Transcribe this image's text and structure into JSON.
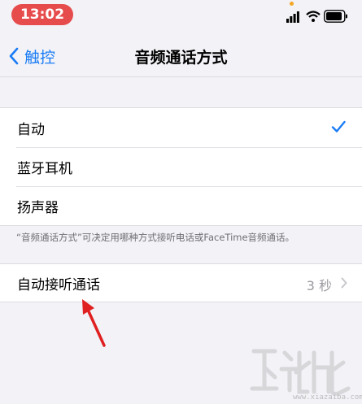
{
  "status_bar": {
    "time": "13:02"
  },
  "nav": {
    "back_label": "触控",
    "title": "音频通话方式"
  },
  "options": {
    "items": [
      {
        "label": "自动",
        "selected": true
      },
      {
        "label": "蓝牙耳机",
        "selected": false
      },
      {
        "label": "扬声器",
        "selected": false
      }
    ]
  },
  "footnote": "“音频通话方式”可决定用哪种方式接听电话或FaceTime音频通话。",
  "auto_answer": {
    "label": "自动接听通话",
    "value": "3 秒"
  },
  "watermark": {
    "url": "www.xiazaiba.com"
  },
  "colors": {
    "accent": "#1a7cf5",
    "time_pill": "#e74c4c",
    "annotation_arrow": "#e02020",
    "background": "#f2f2f7"
  }
}
